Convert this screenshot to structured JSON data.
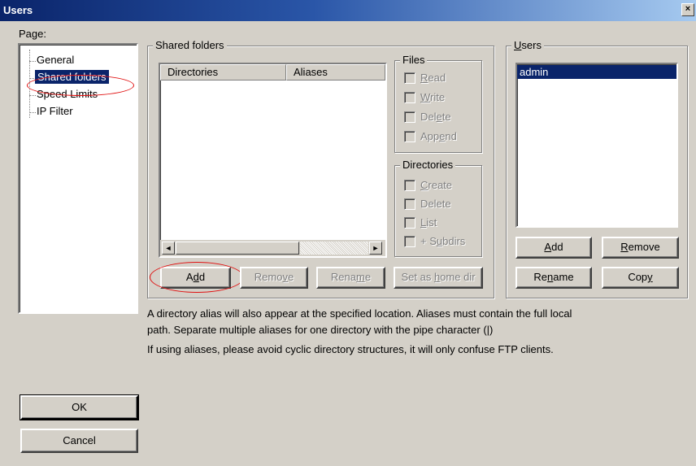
{
  "window": {
    "title": "Users",
    "close_glyph": "×"
  },
  "page_panel": {
    "label": "Page:",
    "items": [
      {
        "label": "General"
      },
      {
        "label": "Shared folders"
      },
      {
        "label": "Speed Limits"
      },
      {
        "label": "IP Filter"
      }
    ],
    "selected": "Shared folders"
  },
  "shared_folders": {
    "group_label": "Shared folders",
    "columns": [
      {
        "label": "Directories"
      },
      {
        "label": "Aliases"
      }
    ],
    "rows": [],
    "scroll_left_glyph": "◄",
    "scroll_right_glyph": "►",
    "buttons": {
      "add": {
        "pre": "A",
        "ul": "d",
        "post": "d"
      },
      "remove": {
        "pre": "Remo",
        "ul": "v",
        "post": "e"
      },
      "rename": {
        "pre": "Rena",
        "ul": "m",
        "post": "e"
      },
      "home": {
        "pre": "Set as ",
        "ul": "h",
        "post": "ome dir"
      }
    }
  },
  "files_group": {
    "label": "Files",
    "items": [
      {
        "pre": "",
        "ul": "R",
        "post": "ead"
      },
      {
        "pre": "",
        "ul": "W",
        "post": "rite"
      },
      {
        "pre": "Del",
        "ul": "e",
        "post": "te"
      },
      {
        "pre": "App",
        "ul": "e",
        "post": "nd"
      }
    ]
  },
  "directories_group": {
    "label": "Directories",
    "items": [
      {
        "pre": "",
        "ul": "C",
        "post": "reate"
      },
      {
        "pre": "Dele",
        "ul": "",
        "post": "te"
      },
      {
        "pre": "",
        "ul": "L",
        "post": "ist"
      },
      {
        "pre": "+ S",
        "ul": "u",
        "post": "bdirs"
      }
    ]
  },
  "users_panel": {
    "group_label_ul": "U",
    "group_label_rest": "sers",
    "list": [
      "admin"
    ],
    "selected": "admin",
    "buttons": {
      "add": {
        "pre": "",
        "ul": "A",
        "post": "dd"
      },
      "remove": {
        "pre": "",
        "ul": "R",
        "post": "emove"
      },
      "rename": {
        "pre": "Re",
        "ul": "n",
        "post": "ame"
      },
      "copy": {
        "pre": "Cop",
        "ul": "y",
        "post": ""
      }
    }
  },
  "description": {
    "line1": "A directory alias will also appear at the specified location. Aliases must contain the full local",
    "line2": "path. Separate multiple aliases for one directory with the pipe character (|)",
    "line3": "If using aliases, please avoid cyclic directory structures, it will only confuse FTP clients."
  },
  "dialog_buttons": {
    "ok": "OK",
    "cancel": "Cancel"
  },
  "colors": {
    "dialog_bg": "#d4d0c8",
    "titlebar": "#0a246a",
    "selection": "#0a246a",
    "annotation_red": "#e01010"
  }
}
